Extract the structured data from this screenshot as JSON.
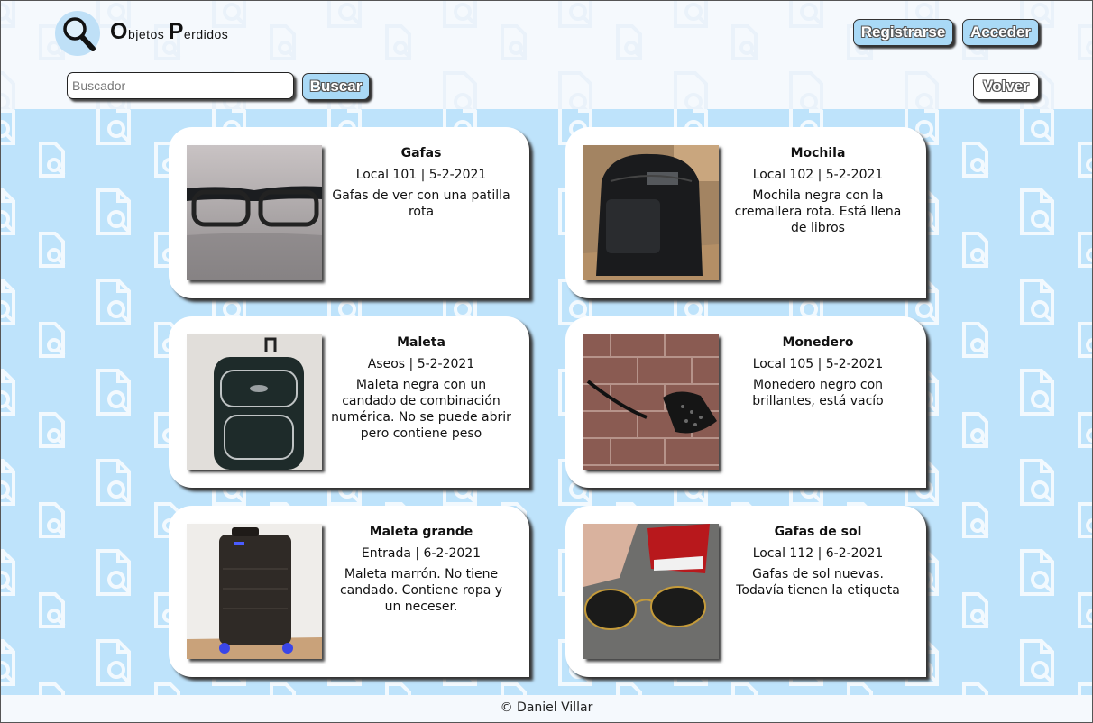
{
  "brand": {
    "word1_initial": "O",
    "word1_rest": "bjetos",
    "word2_initial": "P",
    "word2_rest": "erdidos",
    "logo_icon": "magnifier-icon"
  },
  "header": {
    "register_label": "Registrarse",
    "login_label": "Acceder",
    "search_placeholder": "Buscador",
    "search_value": "",
    "search_button_label": "Buscar",
    "back_label": "Volver"
  },
  "items": [
    {
      "title": "Gafas",
      "meta": "Local 101 | 5-2-2021",
      "desc": "Gafas de ver con una patilla rota",
      "image": "glasses-photo"
    },
    {
      "title": "Mochila",
      "meta": "Local 102 | 5-2-2021",
      "desc": "Mochila negra con la cremallera rota. Está llena de libros",
      "image": "backpack-photo"
    },
    {
      "title": "Maleta",
      "meta": "Aseos | 5-2-2021",
      "desc": "Maleta negra con un candado de combinación numérica. No se puede abrir pero contiene peso",
      "image": "suitcase-photo"
    },
    {
      "title": "Monedero",
      "meta": "Local 105 | 5-2-2021",
      "desc": "Monedero negro con brillantes, está vacío",
      "image": "purse-photo"
    },
    {
      "title": "Maleta grande",
      "meta": "Entrada | 6-2-2021",
      "desc": "Maleta marrón. No tiene candado. Contiene ropa y un neceser.",
      "image": "large-suitcase-photo"
    },
    {
      "title": "Gafas de sol",
      "meta": "Local 112 | 6-2-2021",
      "desc": "Gafas de sol nuevas. Todavía tienen la etiqueta",
      "image": "sunglasses-photo"
    }
  ],
  "footer": {
    "copyright": "© Daniel Villar"
  },
  "colors": {
    "accent": "#a9d9f6",
    "background": "#bee3fb",
    "header": "#f5f9fd"
  }
}
